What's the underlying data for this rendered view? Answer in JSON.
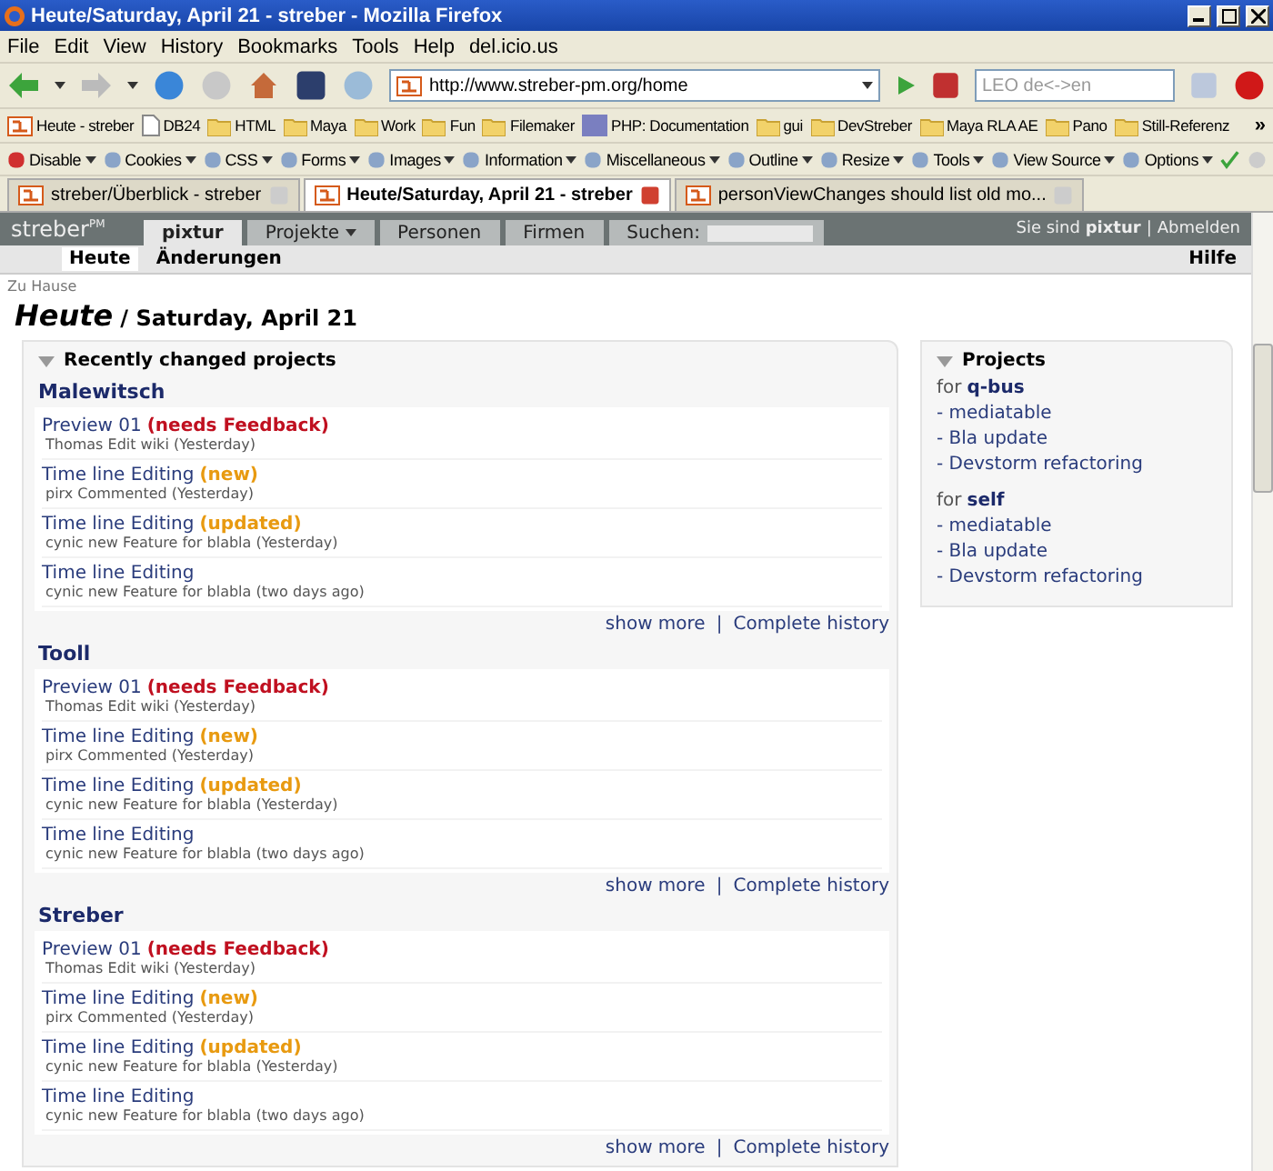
{
  "window": {
    "title": "Heute/Saturday, April 21 - streber - Mozilla Firefox"
  },
  "menubar": [
    "File",
    "Edit",
    "View",
    "History",
    "Bookmarks",
    "Tools",
    "Help",
    "del.icio.us"
  ],
  "navbar": {
    "url": "http://www.streber-pm.org/home",
    "search_placeholder": "LEO de<->en"
  },
  "bookmarks": [
    {
      "label": "Heute - streber",
      "kind": "site"
    },
    {
      "label": "DB24",
      "kind": "page"
    },
    {
      "label": "HTML",
      "kind": "folder"
    },
    {
      "label": "Maya",
      "kind": "folder"
    },
    {
      "label": "Work",
      "kind": "folder"
    },
    {
      "label": "Fun",
      "kind": "folder"
    },
    {
      "label": "Filemaker",
      "kind": "folder"
    },
    {
      "label": "PHP: Documentation",
      "kind": "php"
    },
    {
      "label": "gui",
      "kind": "folder"
    },
    {
      "label": "DevStreber",
      "kind": "folder"
    },
    {
      "label": "Maya RLA AE",
      "kind": "folder"
    },
    {
      "label": "Pano",
      "kind": "folder"
    },
    {
      "label": "Still-Referenz",
      "kind": "folder"
    }
  ],
  "bookmarks_overflow": "»",
  "devbar": [
    "Disable",
    "Cookies",
    "CSS",
    "Forms",
    "Images",
    "Information",
    "Miscellaneous",
    "Outline",
    "Resize",
    "Tools",
    "View Source",
    "Options"
  ],
  "tabs": [
    {
      "label": "streber/Überblick - streber",
      "selected": false
    },
    {
      "label": "Heute/Saturday, April 21 - streber",
      "selected": true
    },
    {
      "label": "personViewChanges should list old mo...",
      "selected": false
    }
  ],
  "app": {
    "logo": "streber",
    "logo_sup": "PM",
    "nav_tabs": [
      {
        "label": "pixtur",
        "selected": true,
        "kind": "plain"
      },
      {
        "label": "Projekte",
        "selected": false,
        "kind": "dropdown"
      },
      {
        "label": "Personen",
        "selected": false,
        "kind": "plain"
      },
      {
        "label": "Firmen",
        "selected": false,
        "kind": "plain"
      }
    ],
    "search_label": "Suchen:",
    "user_prefix": "Sie sind",
    "user_name": "pixtur",
    "user_separator": "|",
    "logout": "Abmelden"
  },
  "subnav": {
    "items": [
      {
        "label": "Heute",
        "selected": true
      },
      {
        "label": "Änderungen",
        "selected": false
      }
    ],
    "help": "Hilfe"
  },
  "breadcrumb": "Zu Hause",
  "heading": {
    "title": "Heute",
    "subtitle": "/ Saturday, April 21"
  },
  "main_panel": {
    "title": "Recently changed projects",
    "projects": [
      {
        "name": "Malewitsch",
        "items": [
          {
            "title": "Preview 01",
            "status": "(needs Feedback)",
            "kind": "feedback",
            "meta": "Thomas Edit wiki (Yesterday)"
          },
          {
            "title": "Time line Editing",
            "status": "(new)",
            "kind": "new",
            "meta": "pirx Commented (Yesterday)"
          },
          {
            "title": "Time line Editing",
            "status": "(updated)",
            "kind": "updated",
            "meta": "cynic new Feature for blabla (Yesterday)"
          },
          {
            "title": "Time line Editing",
            "kind": "plain",
            "meta": "cynic new Feature for blabla (two days ago)"
          }
        ],
        "show_more": "show more",
        "separator": "|",
        "history": "Complete history"
      },
      {
        "name": "Tooll",
        "items": [
          {
            "title": "Preview 01",
            "status": "(needs Feedback)",
            "kind": "feedback",
            "meta": "Thomas Edit wiki (Yesterday)"
          },
          {
            "title": "Time line Editing",
            "status": "(new)",
            "kind": "new",
            "meta": "pirx Commented (Yesterday)"
          },
          {
            "title": "Time line Editing",
            "status": "(updated)",
            "kind": "updated",
            "meta": "cynic new Feature for blabla (Yesterday)"
          },
          {
            "title": "Time line Editing",
            "kind": "plain",
            "meta": "cynic new Feature for blabla (two days ago)"
          }
        ],
        "show_more": "show more",
        "separator": "|",
        "history": "Complete history"
      },
      {
        "name": "Streber",
        "items": [
          {
            "title": "Preview 01",
            "status": "(needs Feedback)",
            "kind": "feedback",
            "meta": "Thomas Edit wiki (Yesterday)"
          },
          {
            "title": "Time line Editing",
            "status": "(new)",
            "kind": "new",
            "meta": "pirx Commented (Yesterday)"
          },
          {
            "title": "Time line Editing",
            "status": "(updated)",
            "kind": "updated",
            "meta": "cynic new Feature for blabla (Yesterday)"
          },
          {
            "title": "Time line Editing",
            "kind": "plain",
            "meta": "cynic new Feature for blabla (two days ago)"
          }
        ],
        "show_more": "show more",
        "separator": "|",
        "history": "Complete history"
      }
    ]
  },
  "side_panel": {
    "title": "Projects",
    "groups": [
      {
        "prefix": "for",
        "name": "q-bus",
        "items": [
          "- mediatable",
          "- Bla update",
          "- Devstorm refactoring"
        ]
      },
      {
        "prefix": "for",
        "name": "self",
        "items": [
          "- mediatable",
          "- Bla update",
          "- Devstorm refactoring"
        ]
      }
    ]
  }
}
